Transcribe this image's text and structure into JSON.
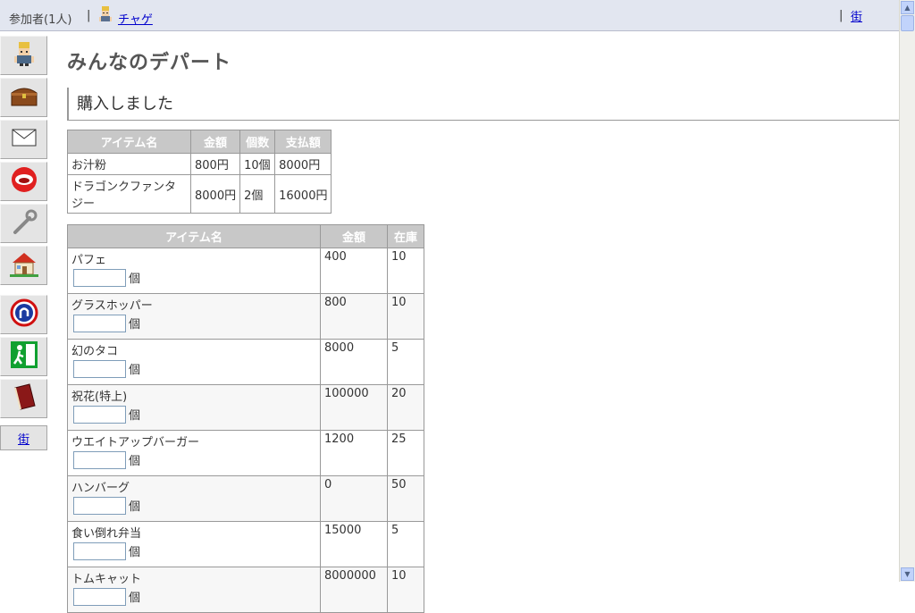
{
  "topbar": {
    "participants_label": "参加者(1人)",
    "separator": "|",
    "user_name": "チャゲ",
    "town_link": "街"
  },
  "leftnav": {
    "items": [
      {
        "icon": "character-icon"
      },
      {
        "icon": "treasure-chest-icon"
      },
      {
        "icon": "mail-icon"
      },
      {
        "icon": "mouth-icon"
      },
      {
        "icon": "wrench-icon"
      },
      {
        "icon": "house-icon"
      },
      {
        "icon": "u-turn-icon"
      },
      {
        "icon": "exit-icon"
      },
      {
        "icon": "book-icon"
      }
    ],
    "town_label": "街"
  },
  "main": {
    "title": "みんなのデパート",
    "notice": "購入しました",
    "purchased": {
      "headers": [
        "アイテム名",
        "金額",
        "個数",
        "支払額"
      ],
      "rows": [
        [
          "お汁粉",
          "800円",
          "10個",
          "8000円"
        ],
        [
          "ドラゴンクファンタジー",
          "8000円",
          "2個",
          "16000円"
        ]
      ]
    },
    "stock": {
      "headers": [
        "アイテム名",
        "金額",
        "在庫"
      ],
      "unit": "個",
      "rows": [
        {
          "name": "パフェ",
          "price": "400",
          "stock": "10"
        },
        {
          "name": "グラスホッパー",
          "price": "800",
          "stock": "10"
        },
        {
          "name": "幻のタコ",
          "price": "8000",
          "stock": "5"
        },
        {
          "name": "祝花(特上)",
          "price": "100000",
          "stock": "20"
        },
        {
          "name": "ウエイトアップバーガー",
          "price": "1200",
          "stock": "25"
        },
        {
          "name": "ハンバーグ",
          "price": "0",
          "stock": "50"
        },
        {
          "name": "食い倒れ弁当",
          "price": "15000",
          "stock": "5"
        },
        {
          "name": "トムキャット",
          "price": "8000000",
          "stock": "10"
        }
      ]
    }
  }
}
